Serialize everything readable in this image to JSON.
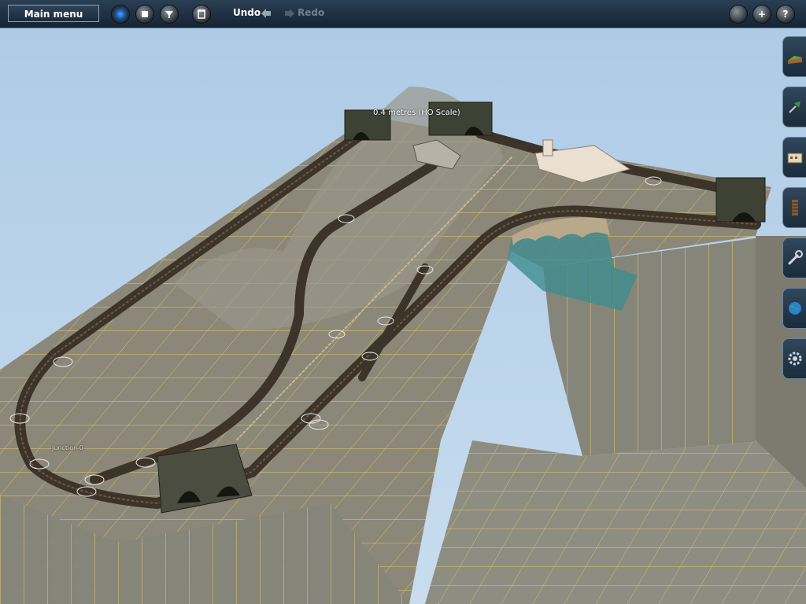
{
  "toolbar": {
    "main_menu_label": "Main menu",
    "undo_label": "Undo",
    "redo_label": "Redo",
    "help_label": "?",
    "add_label": "+"
  },
  "scene": {
    "scale_readout": "0.4 metres  (HO Scale)",
    "junction_label": "Junction 0"
  },
  "side_panel": {
    "tabs": [
      {
        "icon": "terrain-tool-icon"
      },
      {
        "icon": "paint-tree-icon"
      },
      {
        "icon": "objects-icon"
      },
      {
        "icon": "track-tool-icon"
      },
      {
        "icon": "wrench-icon"
      },
      {
        "icon": "globe-icon"
      },
      {
        "icon": "settings-cog-icon"
      }
    ]
  },
  "colors": {
    "sky": "#b9d3ea",
    "toolbar": "#1c2d3e",
    "grid": "#e6cf6c",
    "water": "#3f8c8f"
  }
}
